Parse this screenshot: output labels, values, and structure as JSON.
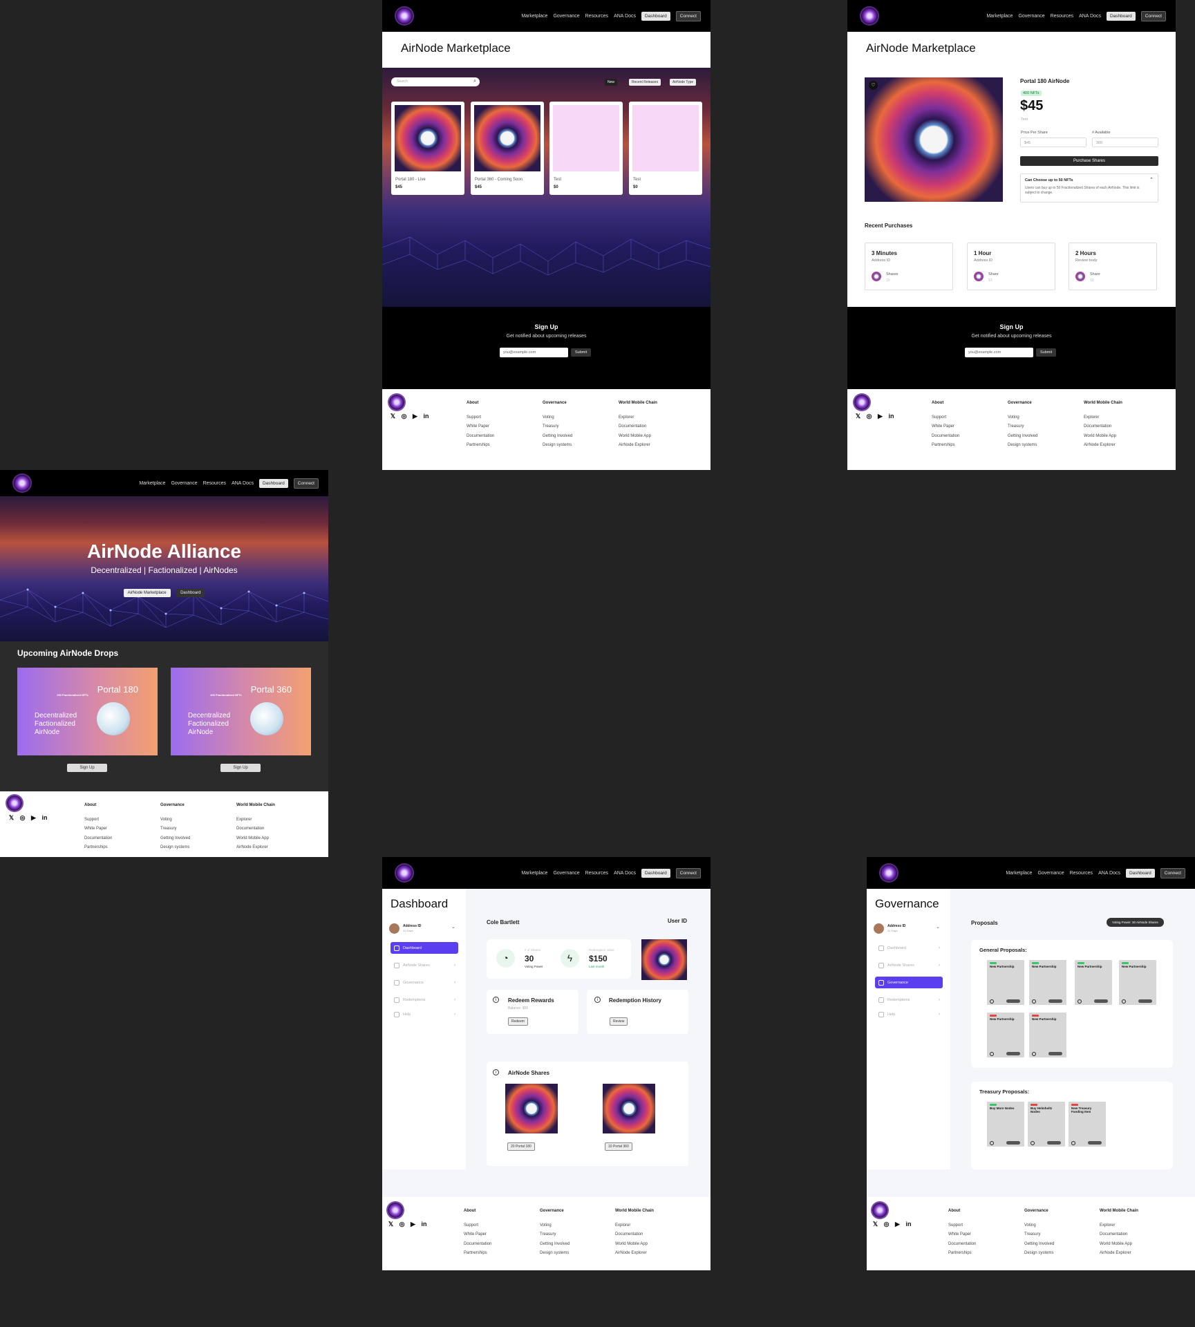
{
  "nav": {
    "marketplace": "Marketplace",
    "governance": "Governance",
    "resources": "Resources",
    "ana_docs": "ANA Docs",
    "dashboard": "Dashboard",
    "connect": "Connect"
  },
  "home": {
    "hero_title": "AirNode Alliance",
    "hero_subtitle": "Decentralized | Factionalized | AirNodes",
    "btn_marketplace": "AirNode Marketplace",
    "btn_dashboard": "Dashboard",
    "drops_title": "Upcoming AirNode Drops",
    "drops": [
      {
        "name": "Portal 180",
        "badge": "250 Fractionalized NFTs",
        "tagline": "Decentralized Factionalized AirNode",
        "signup": "Sign Up"
      },
      {
        "name": "Portal 360",
        "badge": "400 Fractionalized NFTs",
        "tagline": "Decentralized Factionalized AirNode",
        "signup": "Sign Up"
      }
    ]
  },
  "marketplace": {
    "title": "AirNode Marketplace",
    "search_placeholder": "Search",
    "filters": [
      "New",
      "Recent Releases",
      "AirNode Type"
    ],
    "cards": [
      {
        "name": "Portal 180 - Live",
        "price": "$45"
      },
      {
        "name": "Portal 360 - Coming Soon",
        "price": "$45"
      },
      {
        "name": "Test",
        "price": "$0"
      },
      {
        "name": "Test",
        "price": "$0"
      }
    ]
  },
  "signup": {
    "title": "Sign Up",
    "subtitle": "Get notified about upcoming releases",
    "placeholder": "you@example.com",
    "submit": "Submit"
  },
  "product": {
    "title": "AirNode Marketplace",
    "name": "Portal 180 AirNode",
    "nfts_badge": "400 NFTs",
    "price": "$45",
    "test": "Test",
    "price_per_share_label": "Price Per Share",
    "price_per_share": "$45",
    "available_label": "# Available",
    "available": "300",
    "purchase": "Purchase Shares",
    "limit_title": "Can Choose up to 50 NFTs",
    "limit_text": "Users can buy up to 50 Fractionalized Shares of each AirNode. This limit is subject to change.",
    "recent_title": "Recent Purchases",
    "recent": [
      {
        "time": "3 Minutes",
        "who": "Address ID",
        "label": "Shares",
        "val": "10"
      },
      {
        "time": "1 Hour",
        "who": "Address ID",
        "label": "Share",
        "val": "10"
      },
      {
        "time": "2 Hours",
        "who": "Review body",
        "label": "Share",
        "val": "10"
      }
    ]
  },
  "footer": {
    "cols": [
      {
        "h": "About",
        "items": [
          "Support",
          "White Paper",
          "Documentation",
          "Partnerships"
        ]
      },
      {
        "h": "Governance",
        "items": [
          "Voting",
          "Treasury",
          "Getting Involved",
          "Design systems"
        ]
      },
      {
        "h": "World Mobile Chain",
        "items": [
          "Explorer",
          "Documentation",
          "World Mobile App",
          "AirNode Explorer"
        ]
      }
    ]
  },
  "dashboard": {
    "title": "Dashboard",
    "address": "Address ID",
    "days": "31 Days",
    "menu": [
      "Dashboard",
      "AirNode Shares",
      "Governance",
      "Redemptions",
      "Help"
    ],
    "user": "Cole Bartlett",
    "user_id": "User ID",
    "stat1_label": "# of Shares",
    "stat1_value": "30",
    "stat1_sub": "Voting Power",
    "stat2_label": "Redemption Value",
    "stat2_value": "$150",
    "stat2_sub": "Last month",
    "redeem_title": "Redeem Rewards",
    "redeem_balance": "Balance: $55",
    "redeem_btn": "Redeem",
    "history_title": "Redemption History",
    "history_btn": "Review",
    "shares_title": "AirNode Shares",
    "share1": "20 Portal 180",
    "share2": "10 Portal 360"
  },
  "governance": {
    "title": "Governance",
    "proposals": "Proposals",
    "voting_power": "Voting Power: 30 AirNode Shares",
    "general": "General Proposals:",
    "treasury": "Treasury Proposals:",
    "general_cards": [
      "New Partnership",
      "New Partnership",
      "New Partnership",
      "New Partnership",
      "New Partnership",
      "New Partnership"
    ],
    "treasury_cards": [
      "Buy More Nodes",
      "Buy Helmholtz Nodes",
      "New Treasury Funding Item"
    ]
  }
}
